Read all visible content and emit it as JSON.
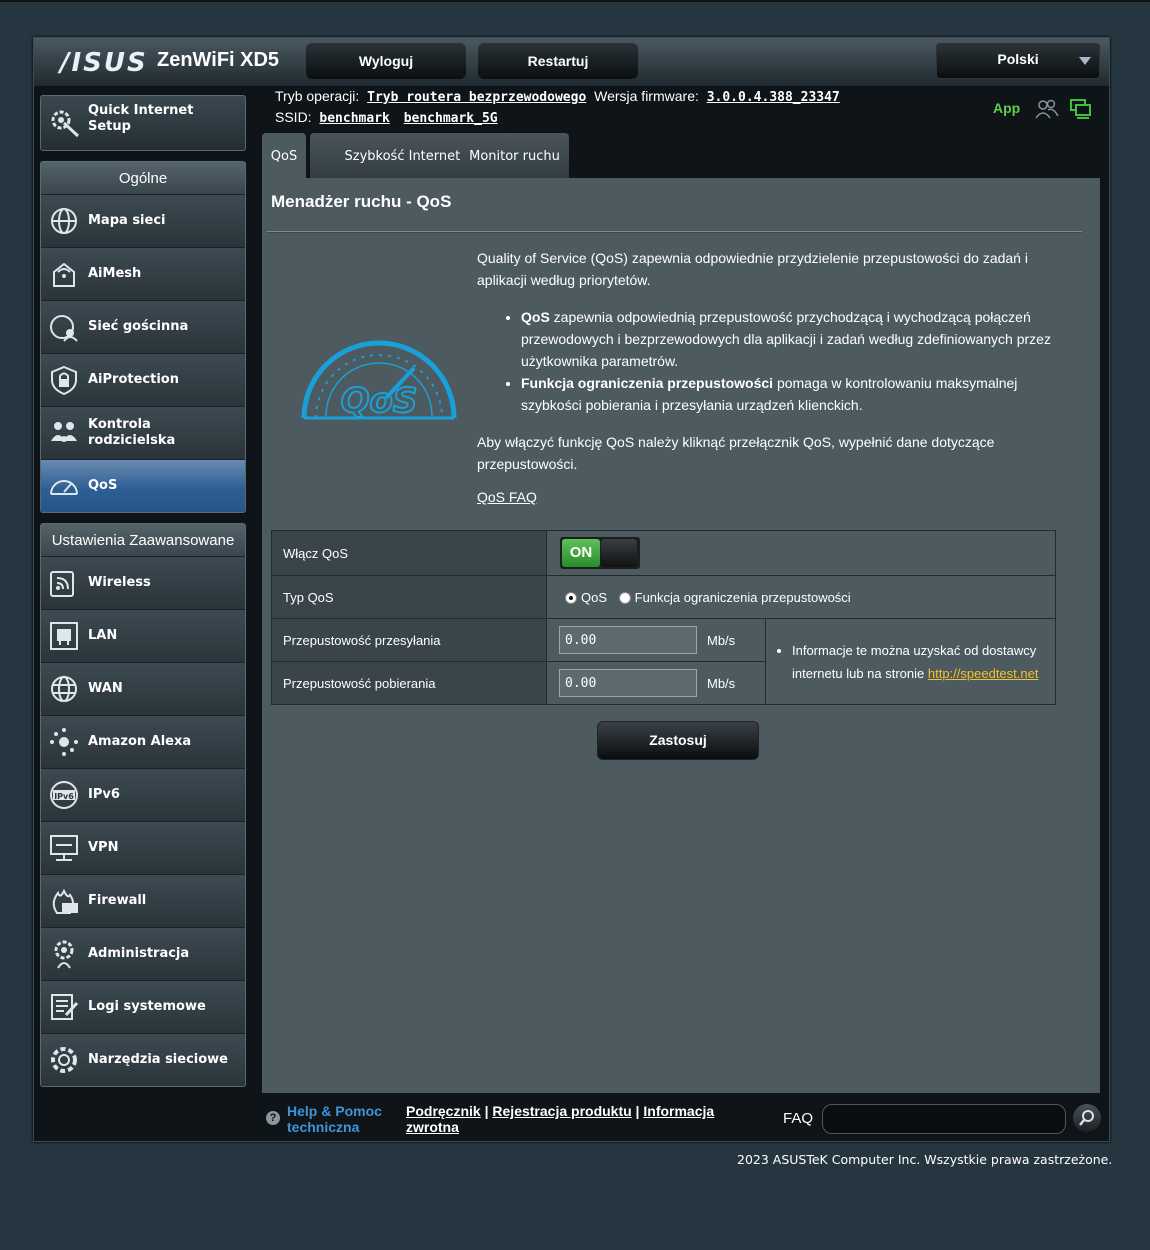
{
  "header": {
    "logo": "/ISUS",
    "model": "ZenWiFi XD5",
    "logout": "Wyloguj",
    "restart": "Restartuj",
    "language": "Polski"
  },
  "status": {
    "mode_label": "Tryb operacji:",
    "mode_value": "Tryb routera bezprzewodowego",
    "fw_label": "Wersja firmware:",
    "fw_value": "3.0.0.4.388_23347",
    "ssid_label": "SSID:",
    "ssid1": "benchmark",
    "ssid2": "benchmark_5G",
    "app": "App"
  },
  "sidebar": {
    "qis": "Quick Internet Setup",
    "general_title": "Ogólne",
    "general": [
      {
        "label": "Mapa sieci",
        "icon": "network-map-icon"
      },
      {
        "label": "AiMesh",
        "icon": "aimesh-icon"
      },
      {
        "label": "Sieć gościnna",
        "icon": "guest-network-icon"
      },
      {
        "label": "AiProtection",
        "icon": "aiprotection-icon"
      },
      {
        "label": "Kontrola rodzicielska",
        "icon": "parental-control-icon"
      },
      {
        "label": "QoS",
        "icon": "qos-icon"
      }
    ],
    "advanced_title": "Ustawienia Zaawansowane",
    "advanced": [
      {
        "label": "Wireless",
        "icon": "wireless-icon"
      },
      {
        "label": "LAN",
        "icon": "lan-icon"
      },
      {
        "label": "WAN",
        "icon": "wan-icon"
      },
      {
        "label": "Amazon Alexa",
        "icon": "alexa-icon"
      },
      {
        "label": "IPv6",
        "icon": "ipv6-icon"
      },
      {
        "label": "VPN",
        "icon": "vpn-icon"
      },
      {
        "label": "Firewall",
        "icon": "firewall-icon"
      },
      {
        "label": "Administracja",
        "icon": "administration-icon"
      },
      {
        "label": "Logi systemowe",
        "icon": "system-log-icon"
      },
      {
        "label": "Narzędzia sieciowe",
        "icon": "network-tools-icon"
      }
    ]
  },
  "tabs": [
    "QoS",
    "Szybkość Internetu",
    "Monitor ruchu"
  ],
  "main": {
    "title": "Menadżer ruchu - QoS",
    "intro": "Quality of Service (QoS) zapewnia odpowiednie przydzielenie przepustowości do zadań i aplikacji według priorytetów.",
    "b1_bold": "QoS",
    "b1_text": " zapewnia odpowiednią przepustowość przychodzącą i wychodzącą połączeń przewodowych i bezprzewodowych dla aplikacji i zadań według zdefiniowanych przez użytkownika parametrów.",
    "b2_bold": "Funkcja ograniczenia przepustowości",
    "b2_text": " pomaga w kontrolowaniu maksymalnej szybkości pobierania i przesyłania urządzeń klienckich.",
    "enable_hint": "Aby włączyć funkcję QoS należy kliknąć przełącznik QoS, wypełnić dane dotyczące przepustowości.",
    "faq_link": "QoS FAQ",
    "logo_text": "QoS",
    "enable_label": "Włącz QoS",
    "switch_on": "ON",
    "type_label": "Typ QoS",
    "type_opt1": "QoS",
    "type_opt2": "Funkcja ograniczenia przepustowości",
    "upload_label": "Przepustowość przesyłania",
    "upload_value": "0.00",
    "download_label": "Przepustowość pobierania",
    "download_value": "0.00",
    "unit": "Mb/s",
    "info_text": "Informacje te można uzyskać od dostawcy internetu lub na stronie ",
    "info_link": "http://speedtest.net",
    "apply": "Zastosuj"
  },
  "footer": {
    "help": "Help & Pomoc techniczna",
    "manual": "Podręcznik",
    "sep": " | ",
    "register": "Rejestracja produktu",
    "feedback": "Informacja zwrotna",
    "faq": "FAQ",
    "copyright": "2023 ASUSTeK Computer Inc. Wszystkie prawa zastrzeżone."
  },
  "colors": {
    "accent_blue": "#2d5f96",
    "switch_green": "#3aa83a",
    "link_yellow": "#f3c229",
    "help_blue": "#3e94d8"
  }
}
